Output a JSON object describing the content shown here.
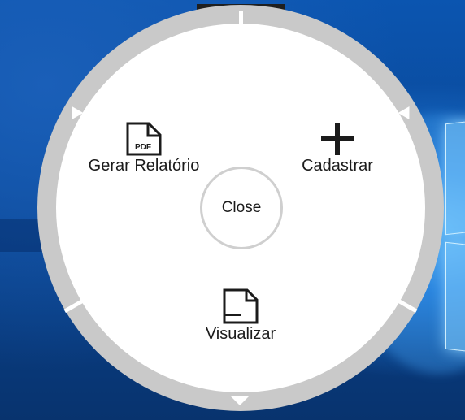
{
  "colors": {
    "ring": "#c9c9c9",
    "panel": "#ffffff",
    "icon": "#1b1b1b",
    "wallpaper_blue": "#0a4796",
    "wallpaper_glow": "#5fb8f5"
  },
  "radial_menu": {
    "items": [
      {
        "label": "Gerar Relatório",
        "icon": "pdf-file-icon"
      },
      {
        "label": "Cadastrar",
        "icon": "plus-icon"
      },
      {
        "label": "Visualizar",
        "icon": "document-icon"
      }
    ],
    "close_label": "Close",
    "expand_arrows": [
      "top-left",
      "top-right",
      "bottom"
    ]
  }
}
